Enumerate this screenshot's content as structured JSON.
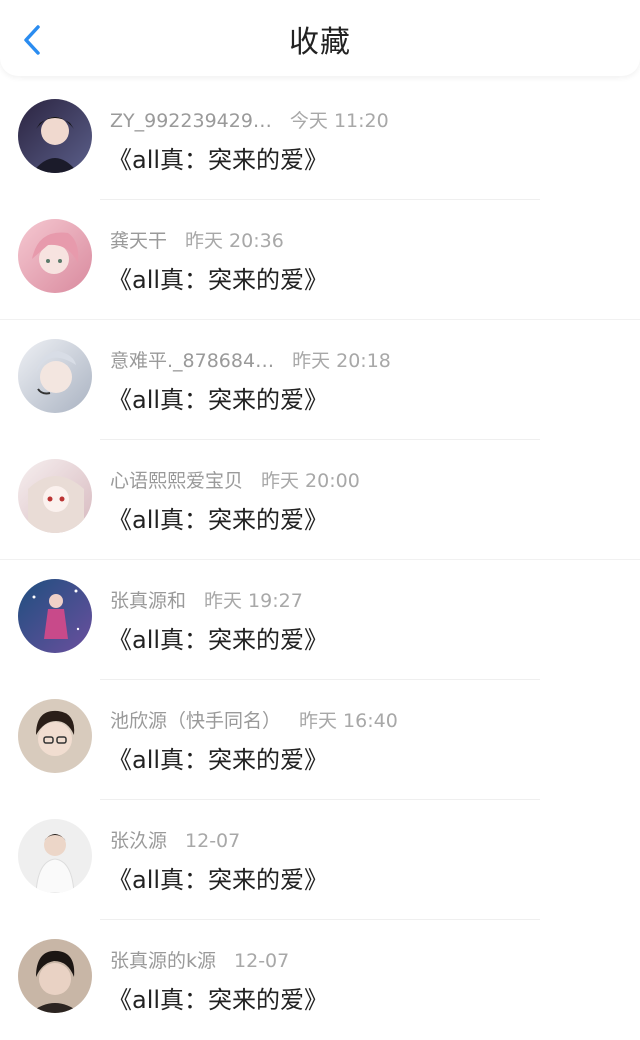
{
  "header": {
    "title": "收藏",
    "back_icon": "chevron-left-icon",
    "accent": "#2a8cf0"
  },
  "items": [
    {
      "name": "ZY_992239429…",
      "time": "今天 11:20",
      "title": "《all真：突来的爱》",
      "avatar_colors": [
        "#2b2440",
        "#5b5f8a"
      ]
    },
    {
      "name": "龚天干",
      "time": "昨天 20:36",
      "title": "《all真：突来的爱》",
      "avatar_colors": [
        "#f2b9c4",
        "#d98a9e"
      ]
    },
    {
      "name": "意难平._878684…",
      "time": "昨天 20:18",
      "title": "《all真：突来的爱》",
      "avatar_colors": [
        "#dfe3ea",
        "#aab3c2"
      ]
    },
    {
      "name": "心语熙熙爱宝贝",
      "time": "昨天 20:00",
      "title": "《all真：突来的爱》",
      "avatar_colors": [
        "#f3e8e8",
        "#c9a0a8"
      ]
    },
    {
      "name": "张真源和",
      "time": "昨天 19:27",
      "title": "《all真：突来的爱》",
      "avatar_colors": [
        "#2a5a8a",
        "#8a5ca8"
      ]
    },
    {
      "name": "池欣源（快手同名）",
      "time": "昨天 16:40",
      "title": "《all真：突来的爱》",
      "avatar_colors": [
        "#d8cbbd",
        "#3a2a22"
      ]
    },
    {
      "name": "张汣源",
      "time": "12-07",
      "title": "《all真：突来的爱》",
      "avatar_colors": [
        "#eeeeee",
        "#cfcfcf"
      ]
    },
    {
      "name": "张真源的k源",
      "time": "12-07",
      "title": "《all真：突来的爱》",
      "avatar_colors": [
        "#4a3b34",
        "#c8b6a6"
      ]
    }
  ]
}
